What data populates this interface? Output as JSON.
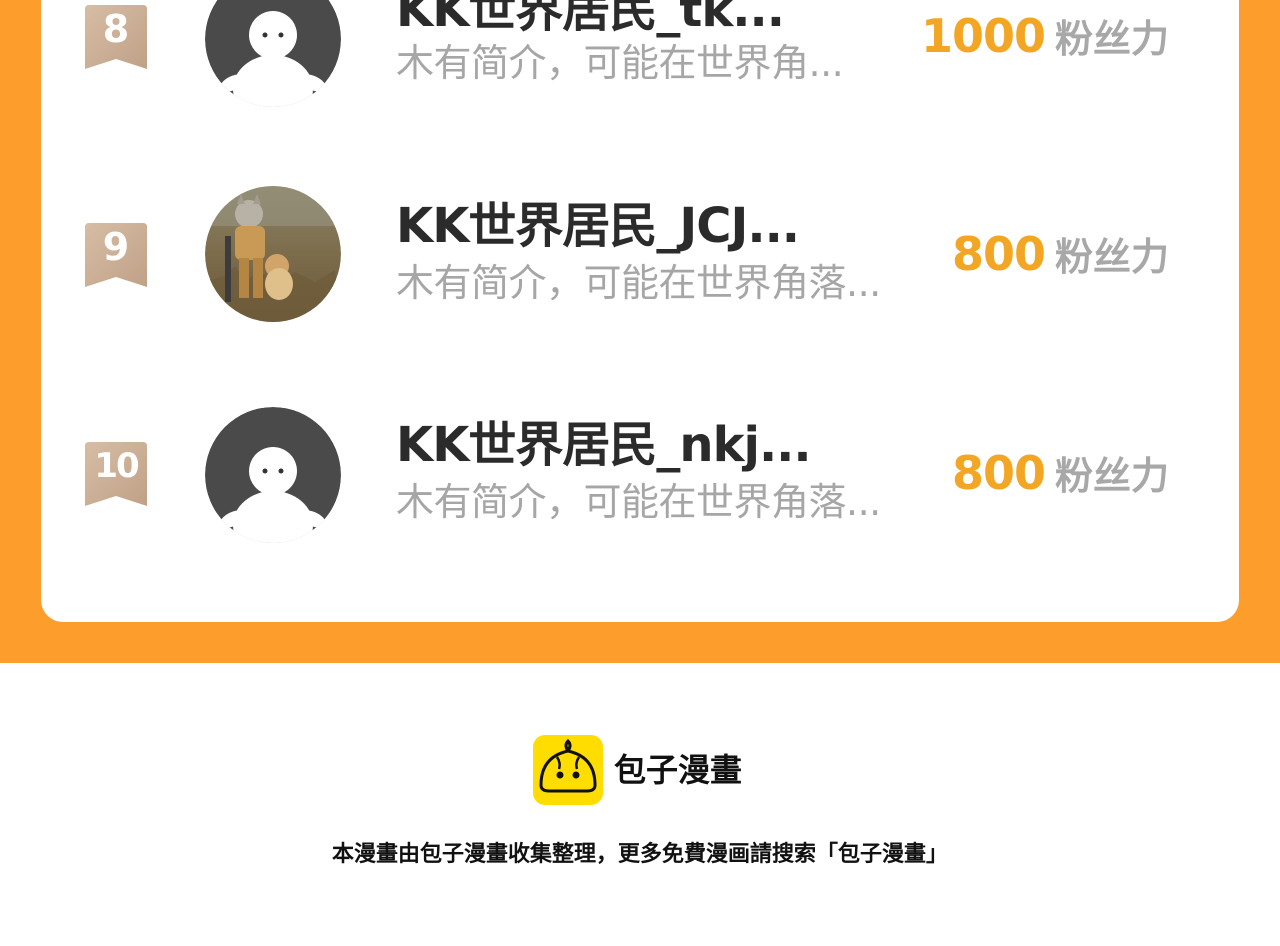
{
  "ranking": {
    "rows": [
      {
        "rank": "8",
        "name": "KK世界居民_tk...",
        "bio": "木有简介，可能在世界角...",
        "fans": "1000",
        "fans_unit": "粉丝力",
        "avatar": "default-avatar"
      },
      {
        "rank": "9",
        "name": "KK世界居民_JCJ...",
        "bio": "木有简介，可能在世界角落...",
        "fans": "800",
        "fans_unit": "粉丝力",
        "avatar": "cat-photo-avatar"
      },
      {
        "rank": "10",
        "name": "KK世界居民_nkj...",
        "bio": "木有简介，可能在世界角落...",
        "fans": "800",
        "fans_unit": "粉丝力",
        "avatar": "default-avatar"
      }
    ]
  },
  "footer": {
    "brand": "包子漫畫",
    "note": "本漫畫由包子漫畫收集整理，更多免費漫画請搜索「包子漫畫」"
  },
  "colors": {
    "accent_orange": "#fd9e2c",
    "fans_number": "#f3a623",
    "rank_badge": "#c9ad95",
    "name_text": "#2b2b2b",
    "muted_text": "#a6a6a6",
    "logo_yellow": "#ffdd00"
  }
}
